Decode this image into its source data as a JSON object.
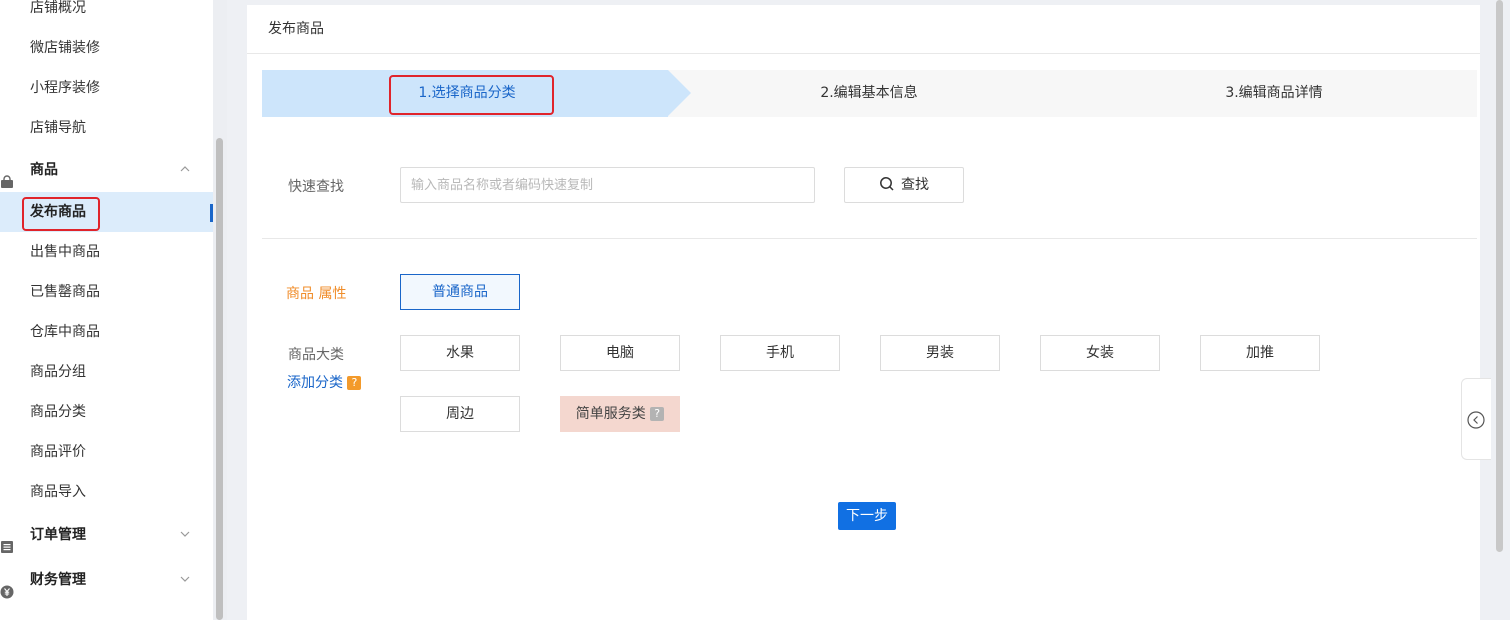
{
  "sidebar": {
    "shop_items": [
      "店铺概况",
      "微店铺装修",
      "小程序装修",
      "店铺导航"
    ],
    "goods_group": {
      "label": "商品",
      "chevron": "up"
    },
    "goods_items": [
      "发布商品",
      "出售中商品",
      "已售罄商品",
      "仓库中商品",
      "商品分组",
      "商品分类",
      "商品评价",
      "商品导入"
    ],
    "active_item": "发布商品",
    "order_group": {
      "label": "订单管理",
      "chevron": "down"
    },
    "finance_group": {
      "label": "财务管理",
      "chevron": "down"
    }
  },
  "panel": {
    "title": "发布商品",
    "steps": [
      {
        "label": "1.选择商品分类",
        "active": true
      },
      {
        "label": "2.编辑基本信息",
        "active": false
      },
      {
        "label": "3.编辑商品详情",
        "active": false
      }
    ],
    "search": {
      "label": "快速查找",
      "placeholder": "输入商品名称或者编码快速复制",
      "button_label": "查找"
    },
    "attribute": {
      "label": "商品 属性",
      "option": "普通商品"
    },
    "category": {
      "label": "商品大类",
      "add_link": "添加分类",
      "help_badge": "?",
      "options": [
        "水果",
        "电脑",
        "手机",
        "男装",
        "女装",
        "加推",
        "周边"
      ],
      "special_option": "简单服务类",
      "special_badge": "?"
    },
    "next_button": "下一步"
  },
  "colors": {
    "accent": "#1a66c9",
    "primary_button": "#1170e3",
    "highlight_box": "#e0242b",
    "attribute_label": "#f08d2a",
    "special_option_bg": "#f4d7cf"
  },
  "icons": {
    "goods_group": "shopping-bag-icon",
    "order_group": "list-icon",
    "finance_group": "yuan-coin-icon",
    "search": "search-icon",
    "float_tab": "chevron-left-circle-icon"
  }
}
